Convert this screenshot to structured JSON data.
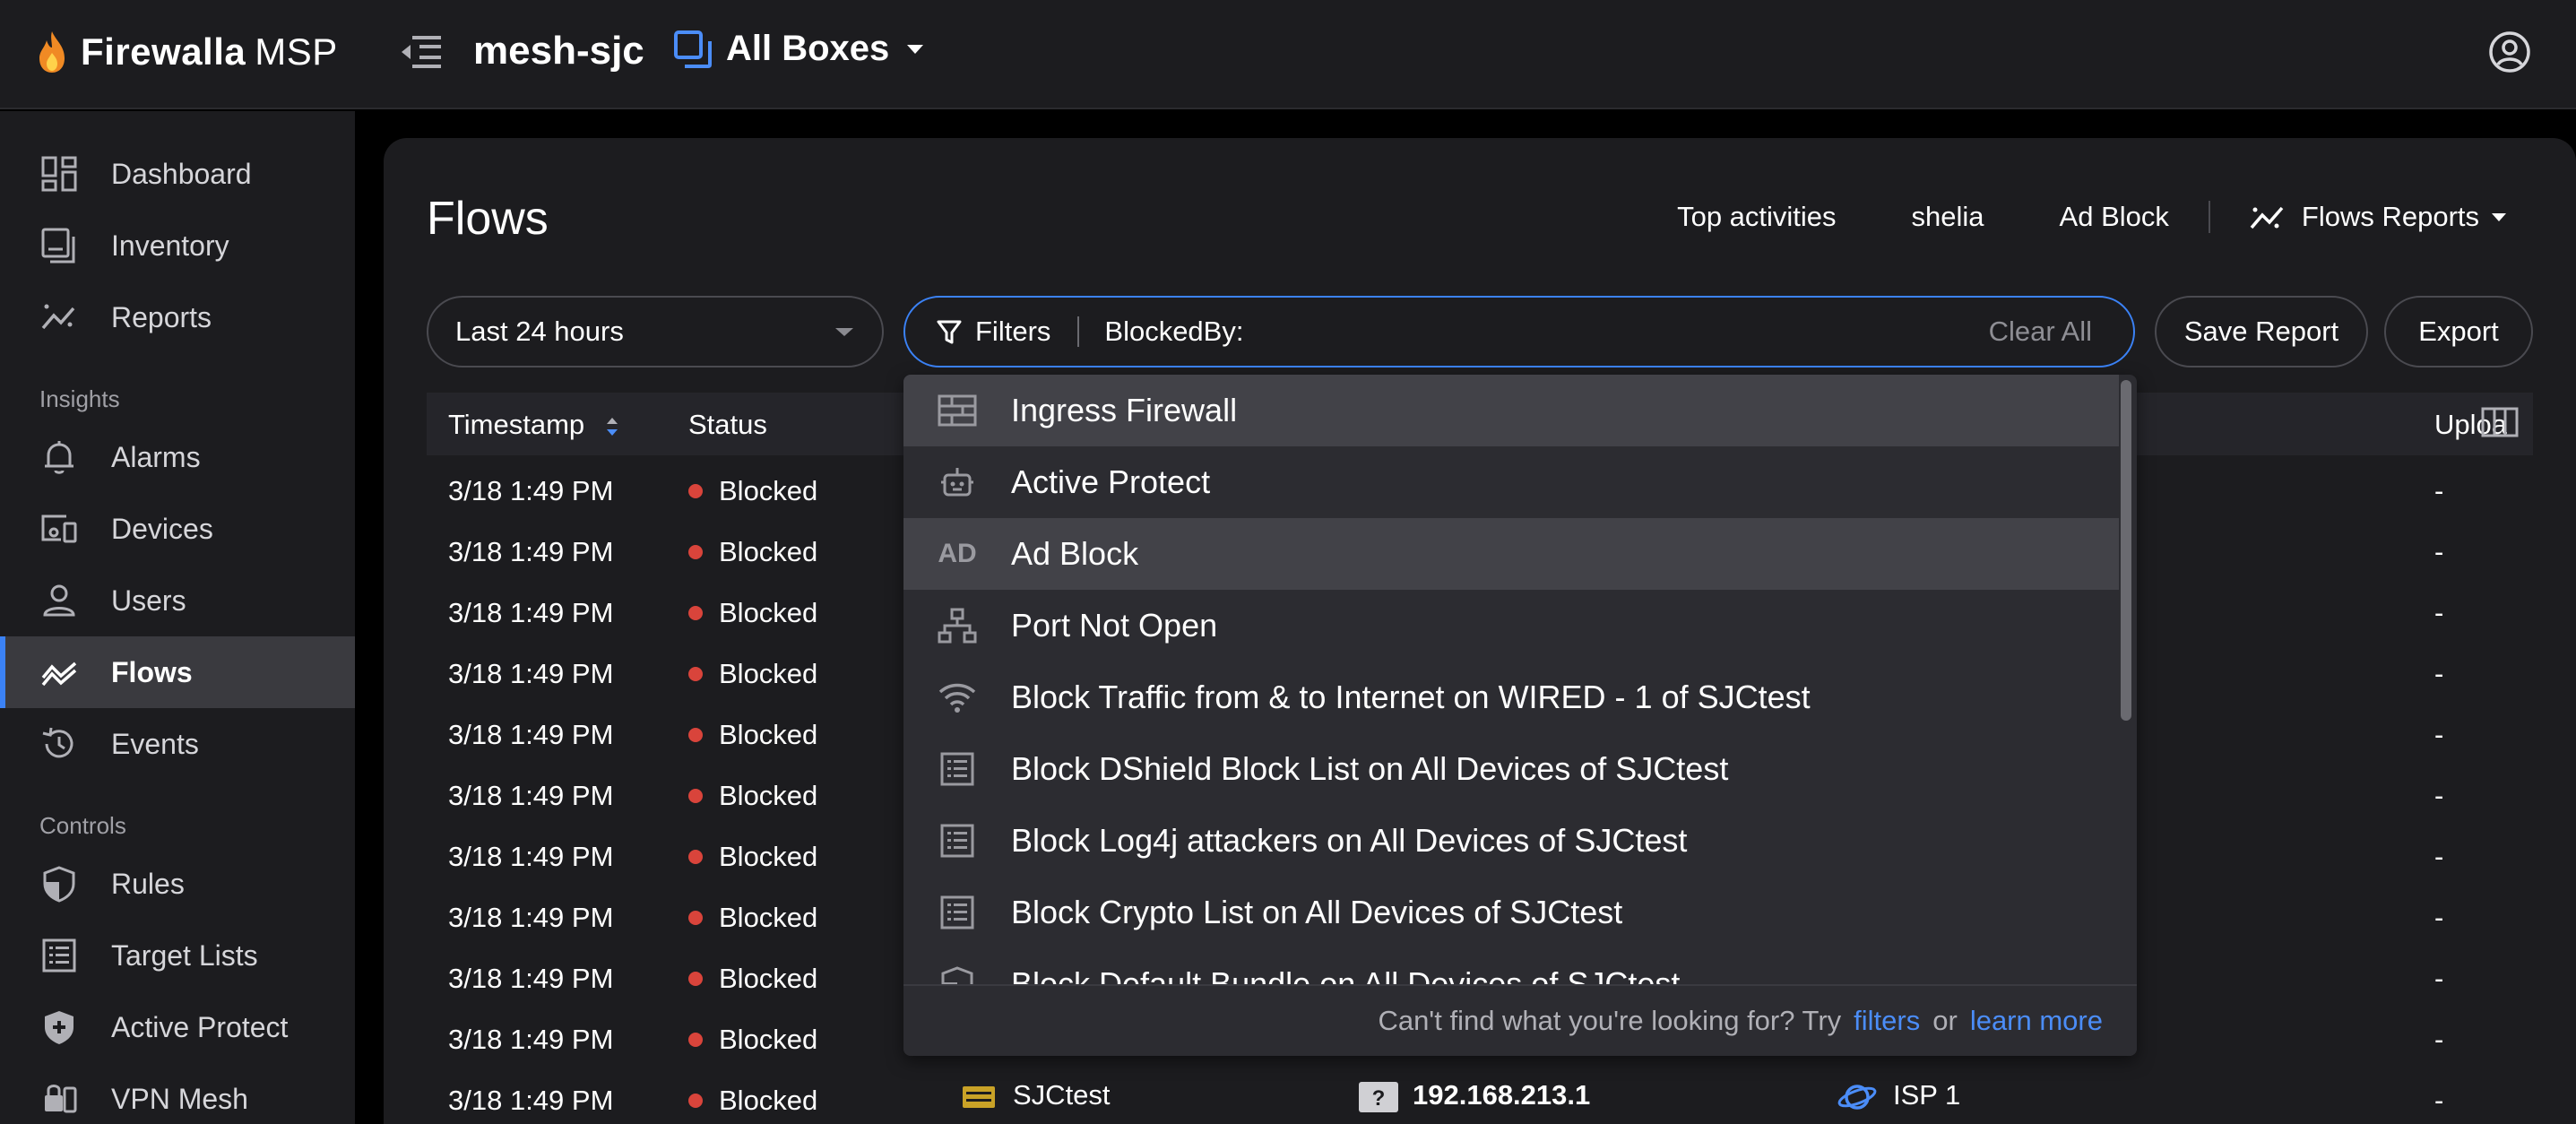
{
  "brand": {
    "name": "Firewalla",
    "suffix": "MSP"
  },
  "header": {
    "box_name": "mesh-sjc",
    "box_selector": "All Boxes"
  },
  "sidebar": {
    "items": [
      {
        "label": "Dashboard",
        "icon": "dashboard-icon"
      },
      {
        "label": "Inventory",
        "icon": "inventory-icon"
      },
      {
        "label": "Reports",
        "icon": "reports-icon"
      }
    ],
    "insights_label": "Insights",
    "insights": [
      {
        "label": "Alarms",
        "icon": "bell-icon"
      },
      {
        "label": "Devices",
        "icon": "devices-icon"
      },
      {
        "label": "Users",
        "icon": "user-icon"
      },
      {
        "label": "Flows",
        "icon": "flows-icon",
        "active": true
      },
      {
        "label": "Events",
        "icon": "history-icon"
      }
    ],
    "controls_label": "Controls",
    "controls": [
      {
        "label": "Rules",
        "icon": "shield-icon"
      },
      {
        "label": "Target Lists",
        "icon": "list-icon"
      },
      {
        "label": "Active Protect",
        "icon": "shield-plus-icon"
      },
      {
        "label": "VPN Mesh",
        "icon": "vpn-icon"
      }
    ]
  },
  "page": {
    "title": "Flows",
    "links": [
      "Top activities",
      "shelia",
      "Ad Block"
    ],
    "flows_reports": "Flows Reports"
  },
  "toolbar": {
    "time_range": "Last 24 hours",
    "filters_label": "Filters",
    "filter_value": "BlockedBy:",
    "clear_all": "Clear All",
    "save_report": "Save Report",
    "export": "Export"
  },
  "table": {
    "columns": {
      "timestamp": "Timestamp",
      "status": "Status",
      "upload": "Uploa"
    },
    "rows": [
      {
        "timestamp": "3/18 1:49 PM",
        "status": "Blocked",
        "upload": "-"
      },
      {
        "timestamp": "3/18 1:49 PM",
        "status": "Blocked",
        "upload": "-"
      },
      {
        "timestamp": "3/18 1:49 PM",
        "status": "Blocked",
        "upload": "-"
      },
      {
        "timestamp": "3/18 1:49 PM",
        "status": "Blocked",
        "upload": "-"
      },
      {
        "timestamp": "3/18 1:49 PM",
        "status": "Blocked",
        "upload": "-"
      },
      {
        "timestamp": "3/18 1:49 PM",
        "status": "Blocked",
        "upload": "-"
      },
      {
        "timestamp": "3/18 1:49 PM",
        "status": "Blocked",
        "upload": "-"
      },
      {
        "timestamp": "3/18 1:49 PM",
        "status": "Blocked",
        "upload": "-"
      },
      {
        "timestamp": "3/18 1:49 PM",
        "status": "Blocked",
        "upload": "-"
      },
      {
        "timestamp": "3/18 1:49 PM",
        "status": "Blocked",
        "upload": "-"
      },
      {
        "timestamp": "3/18 1:49 PM",
        "status": "Blocked",
        "upload": "-",
        "box": "SJCtest",
        "ip": "192.168.213.1",
        "network": "ISP 1"
      }
    ]
  },
  "dropdown": {
    "items": [
      {
        "label": "Ingress Firewall",
        "icon": "firewall-icon",
        "highlight": true
      },
      {
        "label": "Active Protect",
        "icon": "robot-icon"
      },
      {
        "label": "Ad Block",
        "icon": "ad-icon",
        "icon_text": "AD",
        "highlight": true
      },
      {
        "label": "Port Not Open",
        "icon": "network-icon"
      },
      {
        "label": "Block Traffic from & to Internet on WIRED - 1 of SJCtest",
        "icon": "wifi-icon"
      },
      {
        "label": "Block DShield Block List on All Devices of SJCtest",
        "icon": "list-icon"
      },
      {
        "label": "Block Log4j attackers on All Devices of SJCtest",
        "icon": "list-icon"
      },
      {
        "label": "Block Crypto List on All Devices of SJCtest",
        "icon": "list-icon"
      },
      {
        "label": "Block Default Bundle on All Devices of SJCtest",
        "icon": "shield-icon"
      }
    ],
    "footer_text": "Can't find what you're looking for? Try",
    "footer_link1": "filters",
    "footer_or": "or",
    "footer_link2": "learn more"
  },
  "colors": {
    "accent": "#3b82f6",
    "blocked": "#d9443b",
    "logo_flame": "#f08a24"
  }
}
